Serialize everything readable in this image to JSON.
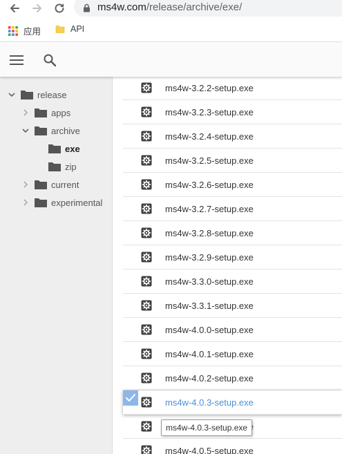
{
  "browser": {
    "url_host": "ms4w.com",
    "url_path": "/release/archive/exe/",
    "bookmarks": [
      {
        "label": "应用",
        "icon": "apps-grid-icon"
      },
      {
        "label": "API",
        "icon": "folder-icon"
      }
    ]
  },
  "header": {
    "menu_icon": "hamburger-menu-icon",
    "search_icon": "search-icon"
  },
  "sidebar": {
    "tree": [
      {
        "label": "release",
        "level": 0,
        "expanded": true
      },
      {
        "label": "apps",
        "level": 1,
        "expanded": false
      },
      {
        "label": "archive",
        "level": 1,
        "expanded": true
      },
      {
        "label": "exe",
        "level": 2,
        "selected": true
      },
      {
        "label": "zip",
        "level": 2
      },
      {
        "label": "current",
        "level": 1,
        "expanded": false
      },
      {
        "label": "experimental",
        "level": 1,
        "expanded": false
      }
    ]
  },
  "files": [
    {
      "name": "ms4w-3.2.2-setup.exe"
    },
    {
      "name": "ms4w-3.2.3-setup.exe"
    },
    {
      "name": "ms4w-3.2.4-setup.exe"
    },
    {
      "name": "ms4w-3.2.5-setup.exe"
    },
    {
      "name": "ms4w-3.2.6-setup.exe"
    },
    {
      "name": "ms4w-3.2.7-setup.exe"
    },
    {
      "name": "ms4w-3.2.8-setup.exe"
    },
    {
      "name": "ms4w-3.2.9-setup.exe"
    },
    {
      "name": "ms4w-3.3.0-setup.exe"
    },
    {
      "name": "ms4w-3.3.1-setup.exe"
    },
    {
      "name": "ms4w-4.0.0-setup.exe"
    },
    {
      "name": "ms4w-4.0.1-setup.exe"
    },
    {
      "name": "ms4w-4.0.2-setup.exe"
    },
    {
      "name": "ms4w-4.0.3-setup.exe",
      "active": true
    },
    {
      "name": "ms4w-4.0.4-setup.exe"
    },
    {
      "name": "ms4w-4.0.5-setup.exe"
    }
  ],
  "tooltip": "ms4w-4.0.3-setup.exe",
  "colors": {
    "accent": "#4a90d9",
    "check_bg": "#8cb7e8",
    "sidebar_bg": "#eeeeee"
  }
}
